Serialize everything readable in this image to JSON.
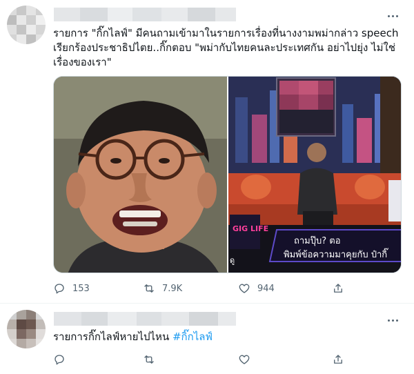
{
  "tweets": [
    {
      "text": "รายการ \"กิ๊กไลฟ์\" มีคนถามเข้ามาในรายการเรื่องที่นางงามพม่ากล่าว speech เรียกร้องประชาธิปไตย..กิ๊กตอบ \"พม่ากับไทยคนละประเทศกัน อย่าไปยุ่ง ไม่ใช่เรื่องของเรา\"",
      "media": {
        "tv_caption_line1": "ถามปุ๊บ? ตอ",
        "tv_caption_line2": "พิมพ์ข้อความมาคุยกับ ป๋ากิ๊",
        "tv_logo_text": "GIG LIFE",
        "tv_small_label": "ดู"
      },
      "stats": {
        "replies": "153",
        "retweets": "7.9K",
        "likes": "944"
      }
    },
    {
      "text_plain": "รายการกิ๊กไลฟ์หายไปไหน ",
      "hashtag": "#กิ๊กไลฟ์",
      "stats": {
        "replies": "",
        "retweets": "",
        "likes": ""
      }
    }
  ],
  "icons": {
    "more": "more-horizontal-icon",
    "reply": "reply-icon",
    "retweet": "retweet-icon",
    "like": "heart-icon",
    "share": "share-icon"
  },
  "colors": {
    "text": "#0f1419",
    "muted": "#536471",
    "link": "#1d9bf0",
    "border": "#eff3f4"
  }
}
